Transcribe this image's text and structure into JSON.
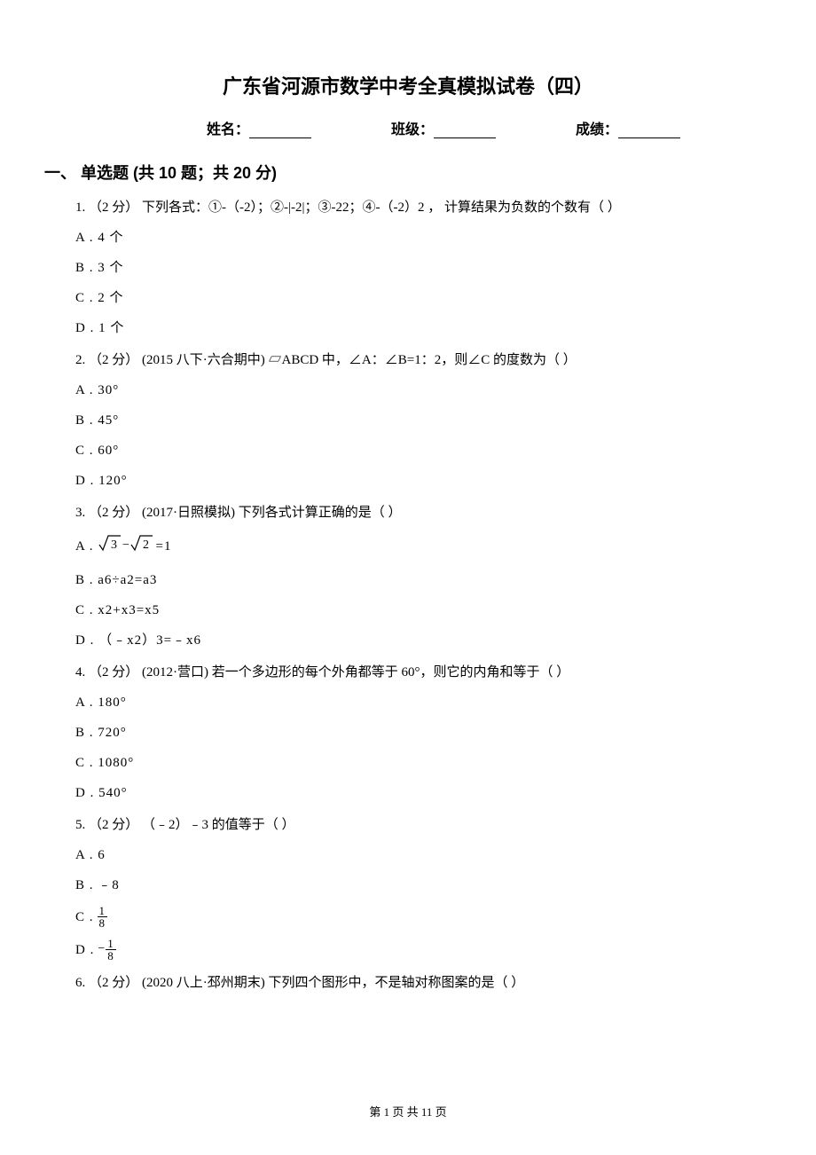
{
  "title": "广东省河源市数学中考全真模拟试卷（四）",
  "info": {
    "name_label": "姓名：",
    "class_label": "班级：",
    "score_label": "成绩："
  },
  "section1": {
    "header": "一、 单选题 (共 10 题；共 20 分)"
  },
  "q1": {
    "text": "1. （2 分） 下列各式：①-（-2）；②-|-2|；③-22；④-（-2）2 ， 计算结果为负数的个数有（   ）",
    "a": "A . 4 个",
    "b": "B . 3 个",
    "c": "C . 2 个",
    "d": "D . 1 个"
  },
  "q2": {
    "text": "2. （2 分） (2015 八下·六合期中) ▱ABCD 中，∠A：∠B=1：2，则∠C 的度数为（   ）",
    "a": "A . 30°",
    "b": "B . 45°",
    "c": "C . 60°",
    "d": "D . 120°"
  },
  "q3": {
    "text": "3. （2 分） (2017·日照模拟) 下列各式计算正确的是（   ）",
    "a_prefix": "A . ",
    "a_suffix": " =1",
    "b": "B . a6÷a2=a3",
    "c": "C . x2+x3=x5",
    "d": "D . （﹣x2）3=﹣x6"
  },
  "q4": {
    "text": "4. （2 分） (2012·营口) 若一个多边形的每个外角都等于 60°，则它的内角和等于（   ）",
    "a": "A . 180°",
    "b": "B . 720°",
    "c": "C . 1080°",
    "d": "D . 540°"
  },
  "q5": {
    "text": "5. （2 分） （﹣2）﹣3 的值等于（   ）",
    "a": "A . 6",
    "b": "B . ﹣8",
    "c_prefix": "C . ",
    "c_num": "1",
    "c_den": "8",
    "d_prefix": "D . ",
    "d_num": "1",
    "d_den": "8"
  },
  "q6": {
    "text": "6. （2 分） (2020 八上·邳州期末) 下列四个图形中，不是轴对称图案的是（   ）"
  },
  "footer": "第 1 页 共 11 页"
}
